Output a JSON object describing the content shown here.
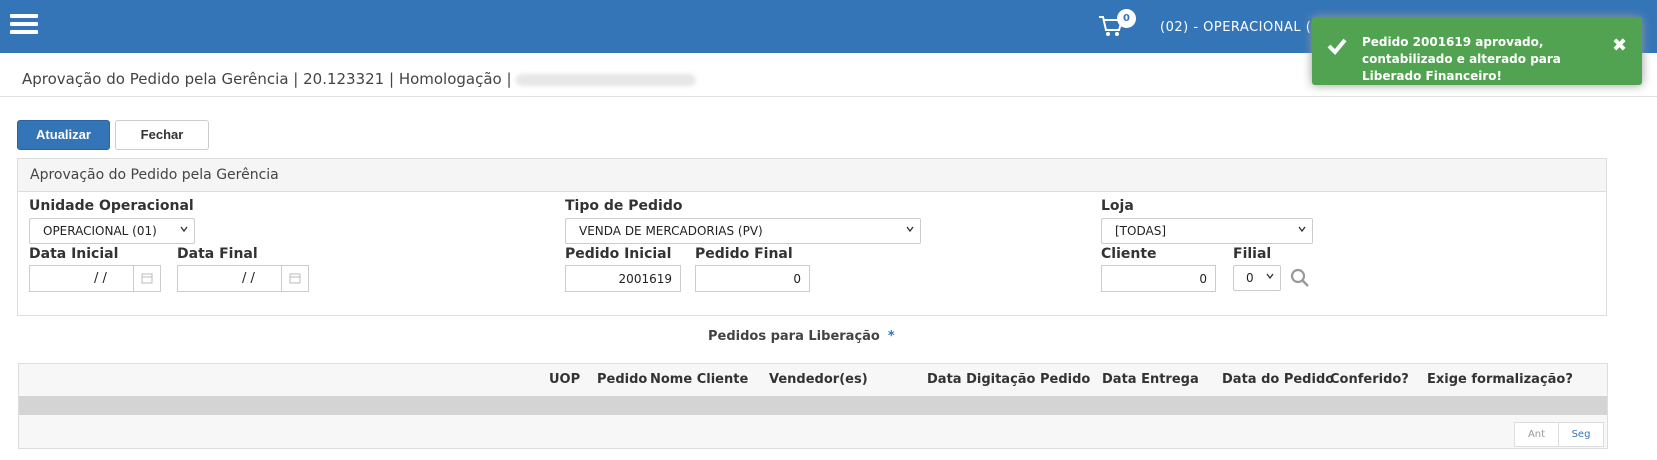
{
  "header": {
    "cart_count": "0",
    "unit_label": "(02) - OPERACIONAL ("
  },
  "toast": {
    "message": "Pedido 2001619 aprovado, contabilizado e alterado para Liberado Financeiro!",
    "color": "#51a351"
  },
  "page": {
    "breadcrumb": "Aprovação do Pedido pela Gerência | 20.123321 | Homologação |"
  },
  "toolbar": {
    "refresh_label": "Atualizar",
    "close_label": "Fechar"
  },
  "filter_panel": {
    "title": "Aprovação do Pedido pela Gerência",
    "unidade_operacional": {
      "label": "Unidade Operacional",
      "value": "OPERACIONAL (01)"
    },
    "tipo_pedido": {
      "label": "Tipo de Pedido",
      "value": "VENDA DE MERCADORIAS (PV)"
    },
    "loja": {
      "label": "Loja",
      "value": "[TODAS]"
    },
    "data_inicial": {
      "label": "Data Inicial",
      "value": "/ /"
    },
    "data_final": {
      "label": "Data Final",
      "value": "/ /"
    },
    "pedido_inicial": {
      "label": "Pedido Inicial",
      "value": "2001619"
    },
    "pedido_final": {
      "label": "Pedido Final",
      "value": "0"
    },
    "cliente": {
      "label": "Cliente",
      "value": "0"
    },
    "filial": {
      "label": "Filial",
      "value": "0"
    }
  },
  "grid": {
    "title": "Pedidos para Liberação",
    "required_marker": "*",
    "columns": [
      "UOP",
      "Pedido",
      "Nome Cliente",
      "Vendedor(es)",
      "Data Digitação Pedido",
      "Data Entrega",
      "Data do Pedido",
      "Conferido?",
      "Exige formalização?"
    ],
    "prev_label": "Ant",
    "next_label": "Seg"
  },
  "colors": {
    "primary": "#3375b7",
    "success": "#51a351"
  }
}
